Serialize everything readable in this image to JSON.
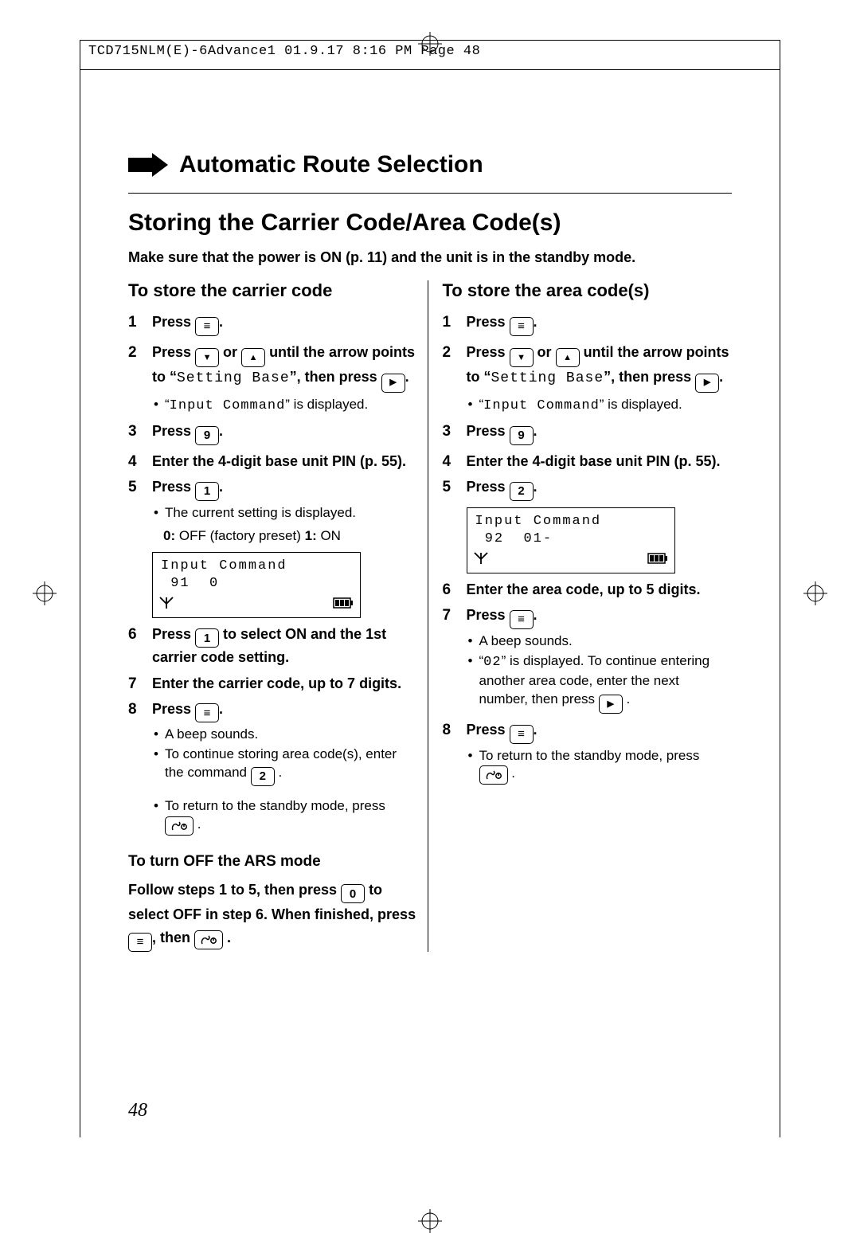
{
  "header": "TCD715NLM(E)-6Advance1  01.9.17 8:16 PM  Page 48",
  "section_title": "Automatic Route Selection",
  "page_title": "Storing the Carrier Code/Area Code(s)",
  "intro": "Make sure that the power is ON (p. 11) and the unit is in the standby mode.",
  "page_number": "48",
  "left": {
    "heading": "To store the carrier code",
    "s1_press": "Press ",
    "period": ".",
    "s2a": "Press ",
    "s2b": " or ",
    "s2c": " until the arrow points to ",
    "s2_quote_open": "“",
    "s2_setting": "Setting Base",
    "s2_quote_close": "”",
    "s2d": ", then press ",
    "s2_note_a": "“",
    "s2_note_b": "Input Command",
    "s2_note_c": "” is displayed.",
    "s3": "Press ",
    "s3_key": "9",
    "s4": "Enter the 4-digit base unit PIN (p. 55).",
    "s5": "Press ",
    "s5_key": "1",
    "s5_note": "The current setting is displayed.",
    "s5_legend_a": "0:",
    "s5_legend_b": " OFF (factory preset)    ",
    "s5_legend_c": "1:",
    "s5_legend_d": " ON",
    "lcd_text": "Input Command\n 91  0",
    "s6a": "Press ",
    "s6_key": "1",
    "s6b": " to select ON and the 1st carrier code setting.",
    "s7": "Enter the carrier code, up to 7 digits.",
    "s8": "Press ",
    "s8_note1": "A beep sounds.",
    "s8_note2a": "To continue storing area code(s), enter the command ",
    "s8_note2_key": "2",
    "s8_note3a": "To return to the standby mode, press ",
    "ars_heading": "To turn OFF the ARS mode",
    "ars_a": "Follow steps 1 to 5, then press ",
    "ars_key": "0",
    "ars_b": " to select OFF in step 6. When finished, press ",
    "ars_c": ", then "
  },
  "right": {
    "heading": "To store the area code(s)",
    "s1_press": "Press ",
    "period": ".",
    "s2a": "Press ",
    "s2b": " or ",
    "s2c": " until the arrow points to ",
    "s2_quote_open": "“",
    "s2_setting": "Setting Base",
    "s2_quote_close": "”",
    "s2d": ", then press ",
    "s2_note_a": "“",
    "s2_note_b": "Input Command",
    "s2_note_c": "” is displayed.",
    "s3": "Press ",
    "s3_key": "9",
    "s4": "Enter the 4-digit base unit PIN (p. 55).",
    "s5": "Press ",
    "s5_key": "2",
    "lcd_text": "Input Command\n 92  01-",
    "s6": "Enter the area code, up to 5 digits.",
    "s7": "Press ",
    "s7_note1": "A beep sounds.",
    "s7_note2a": "“",
    "s7_note2b": "02",
    "s7_note2c": "” is displayed. To continue entering another area code, enter the next number, then press ",
    "s8": "Press ",
    "s8_note": "To return to the standby mode, press "
  }
}
